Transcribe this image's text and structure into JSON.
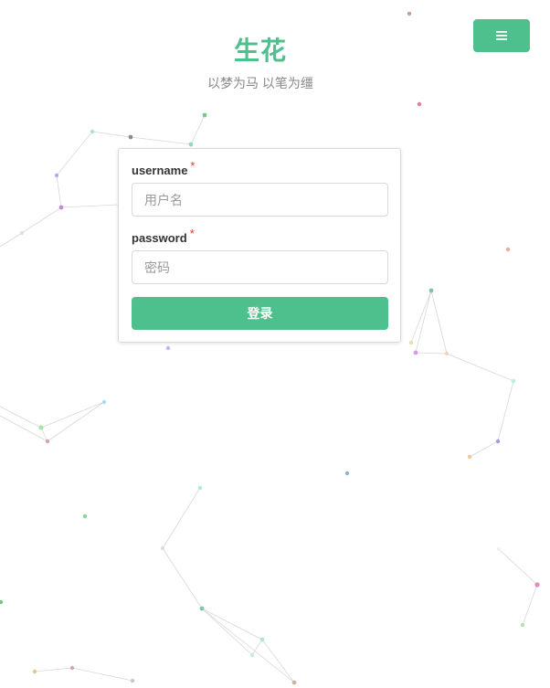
{
  "header": {
    "title": "生花",
    "subtitle": "以梦为马 以笔为缰",
    "menu_icon": "hamburger-icon"
  },
  "login": {
    "username_label": "username",
    "username_placeholder": "用户名",
    "username_value": "",
    "password_label": "password",
    "password_placeholder": "密码",
    "password_value": "",
    "required_mark": "*",
    "submit_label": "登录"
  },
  "colors": {
    "accent": "#4ec08d",
    "required": "#e53935",
    "subtitle": "#888888"
  }
}
